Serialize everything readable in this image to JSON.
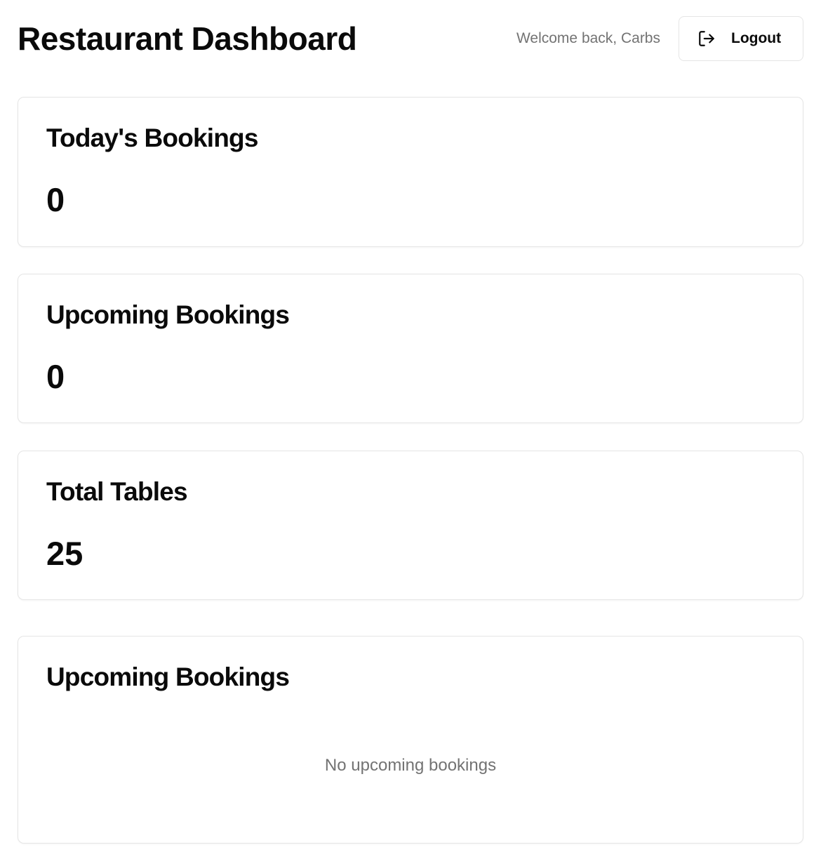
{
  "header": {
    "title": "Restaurant Dashboard",
    "welcome_text": "Welcome back, Carbs",
    "logout_label": "Logout",
    "logout_icon": "log-out-icon"
  },
  "stats": {
    "todays_bookings": {
      "label": "Today's Bookings",
      "value": "0"
    },
    "upcoming_bookings": {
      "label": "Upcoming Bookings",
      "value": "0"
    },
    "total_tables": {
      "label": "Total Tables",
      "value": "25"
    }
  },
  "upcoming_list": {
    "title": "Upcoming Bookings",
    "empty_message": "No upcoming bookings"
  },
  "colors": {
    "text": "#0a0a0a",
    "muted": "#737373",
    "border": "#e5e5e5",
    "background": "#ffffff"
  }
}
